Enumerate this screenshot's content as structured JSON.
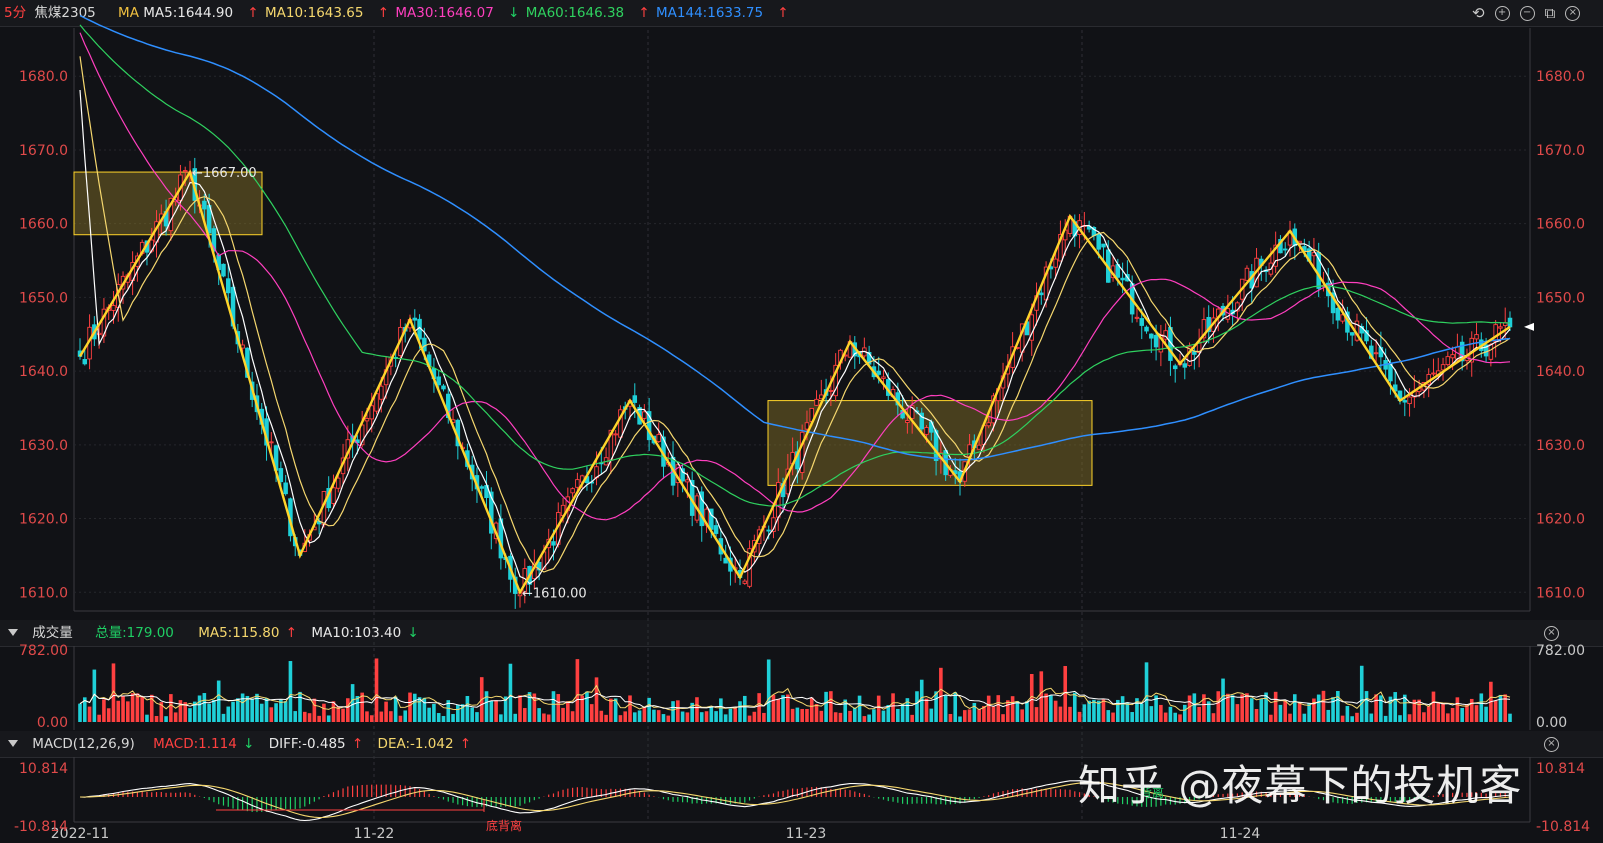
{
  "header": {
    "interval": "5分",
    "symbol": "焦煤2305",
    "ma_label": "MA",
    "ma5": "MA5:1644.90",
    "ma10": "MA10:1643.65",
    "ma30": "MA30:1646.07",
    "ma60": "MA60:1646.38",
    "ma144": "MA144:1633.75",
    "arrow_up": "↑",
    "arrow_down": "↓"
  },
  "volume_header": {
    "title": "成交量",
    "total": "总量:179.00",
    "ma5": "MA5:115.80",
    "ma10": "MA10:103.40"
  },
  "macd_header": {
    "title": "MACD(12,26,9)",
    "macd": "MACD:1.114",
    "diff": "DIFF:-0.485",
    "dea": "DEA:-1.042"
  },
  "watermark": "知乎 @夜幕下的投机客",
  "colors": {
    "up": "#ff4040",
    "down": "#1fd0d8",
    "ma5": "#ffffff",
    "ma10": "#f5d76e",
    "ma30": "#ff3fbf",
    "ma60": "#2fd15f",
    "ma144": "#2f8fff",
    "zigzag": "#ffd42a"
  },
  "chart_data": [
    {
      "type": "candlestick",
      "title": "焦煤2305",
      "ylim": [
        1608,
        1686
      ],
      "y_ticks": [
        "1680.0",
        "1670.0",
        "1660.0",
        "1650.0",
        "1640.0",
        "1630.0",
        "1620.0",
        "1610.0"
      ],
      "x_labels": [
        "2022-11",
        "11-22",
        "11-23",
        "11-24"
      ],
      "annotations": [
        {
          "text": "←1667.00",
          "value": 1667.0
        },
        {
          "text": "←1610.00",
          "value": 1610.0
        }
      ],
      "zigzag": [
        1642,
        1667,
        1615,
        1647,
        1610,
        1636,
        1612,
        1644,
        1625,
        1661,
        1641,
        1659,
        1636,
        1646
      ],
      "boxes": [
        {
          "from": 1658.5,
          "to": 1667.0
        },
        {
          "from": 1624.5,
          "to": 1636.0
        }
      ],
      "series": [
        {
          "name": "MA5"
        },
        {
          "name": "MA10"
        },
        {
          "name": "MA30"
        },
        {
          "name": "MA60"
        },
        {
          "name": "MA144"
        }
      ]
    },
    {
      "type": "bar",
      "title": "成交量",
      "ylim": [
        0,
        782
      ],
      "y_ticks": [
        "782.00",
        "0.00"
      ]
    },
    {
      "type": "bar",
      "title": "MACD(12,26,9)",
      "ylim": [
        -10.814,
        10.814
      ],
      "y_ticks": [
        "10.814",
        "-10.814"
      ],
      "annotations": [
        "底背离",
        "背离"
      ]
    }
  ]
}
